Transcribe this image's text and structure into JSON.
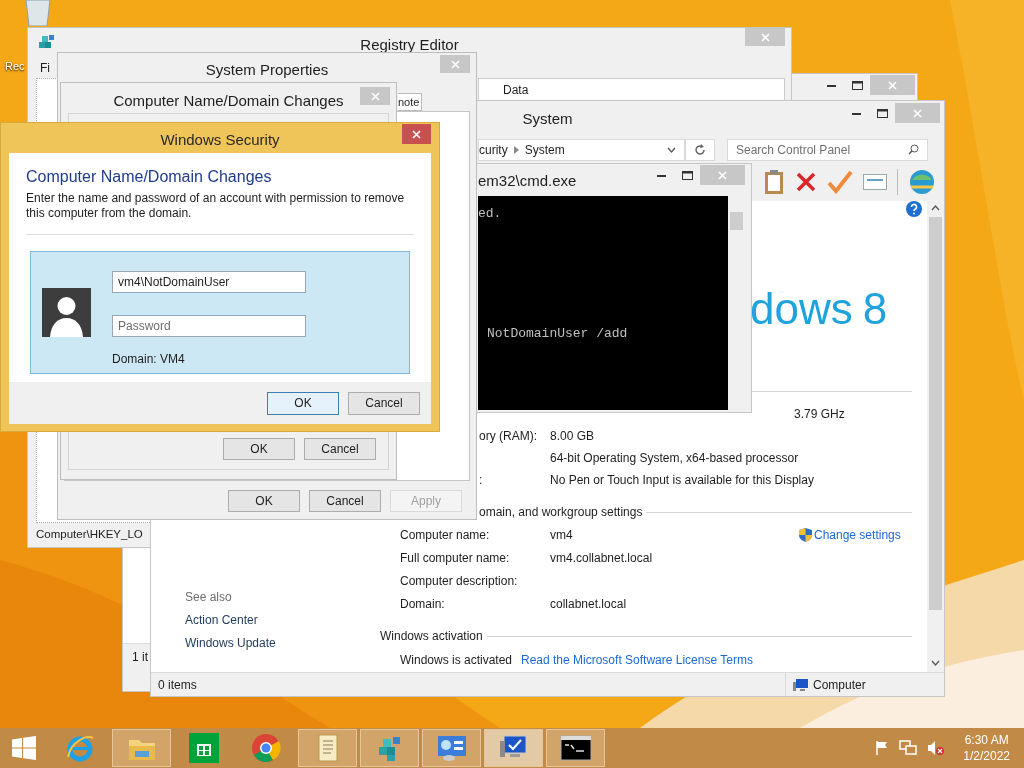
{
  "desktop": {
    "icon_label": "Rec"
  },
  "registry_editor": {
    "title": "Registry Editor",
    "menu": [
      "Fi"
    ],
    "columns": [
      "Data"
    ],
    "status": "Computer\\HKEY_LO"
  },
  "background_window": {
    "status": "1 it"
  },
  "system": {
    "title": "System",
    "breadcrumb": [
      "curity",
      "System"
    ],
    "search": {
      "placeholder": "Search Control Panel"
    },
    "logo": {
      "text": "dows",
      "version": "8"
    },
    "speed": "3.79 GHz",
    "specs": [
      {
        "label": "ory (RAM):",
        "value": "8.00 GB"
      },
      {
        "value": "64-bit Operating System, x64-based processor"
      },
      {
        "label": ":",
        "value": "No Pen or Touch Input is available for this Display"
      }
    ],
    "name_section": {
      "heading": "omain, and workgroup settings",
      "change_link": "Change settings",
      "rows": [
        {
          "label": "Computer name:",
          "value": "vm4"
        },
        {
          "label": "Full computer name:",
          "value": "vm4.collabnet.local"
        },
        {
          "label": "Computer description:"
        },
        {
          "label": "Domain:",
          "value": "collabnet.local"
        }
      ]
    },
    "activation": {
      "heading": "Windows activation",
      "status": "Windows is activated",
      "link": "Read the Microsoft Software License Terms"
    },
    "see_also": {
      "heading": "See also",
      "links": [
        "Action Center",
        "Windows Update"
      ]
    },
    "status_bar": {
      "items": "0 items",
      "location": "Computer"
    }
  },
  "cmd": {
    "title": "em32\\cmd.exe",
    "lines": [
      "ed.",
      "NotDomainUser /add"
    ]
  },
  "system_properties": {
    "title": "System Properties",
    "tab": "note",
    "buttons": [
      {
        "label": "OK",
        "disabled": false
      },
      {
        "label": "Cancel",
        "disabled": false
      },
      {
        "label": "Apply",
        "disabled": true
      }
    ]
  },
  "domain_changes": {
    "title": "Computer Name/Domain Changes",
    "buttons": [
      "OK",
      "Cancel"
    ]
  },
  "security": {
    "title": "Windows Security",
    "heading": "Computer Name/Domain Changes",
    "description": "Enter the name and password of an account with permission to remove this computer from the domain.",
    "username": "vm4\\NotDomainUser",
    "password": {
      "placeholder": "Password"
    },
    "domain": "Domain: VM4",
    "buttons": [
      {
        "label": "OK",
        "focused": true
      },
      {
        "label": "Cancel",
        "focused": false
      }
    ]
  },
  "taskbar": {
    "apps": [
      {
        "kind": "ie",
        "running": false,
        "selected": false
      },
      {
        "kind": "explorer",
        "running": true,
        "selected": false
      },
      {
        "kind": "store",
        "running": false,
        "selected": false
      },
      {
        "kind": "chrome",
        "running": false,
        "selected": false
      },
      {
        "kind": "notepad",
        "running": true,
        "selected": false
      },
      {
        "kind": "regedit",
        "running": true,
        "selected": false
      },
      {
        "kind": "control",
        "running": true,
        "selected": false
      },
      {
        "kind": "computer",
        "running": true,
        "selected": true
      },
      {
        "kind": "cmd",
        "running": true,
        "selected": false
      }
    ],
    "time": "6:30 AM",
    "date": "1/2/2022"
  }
}
